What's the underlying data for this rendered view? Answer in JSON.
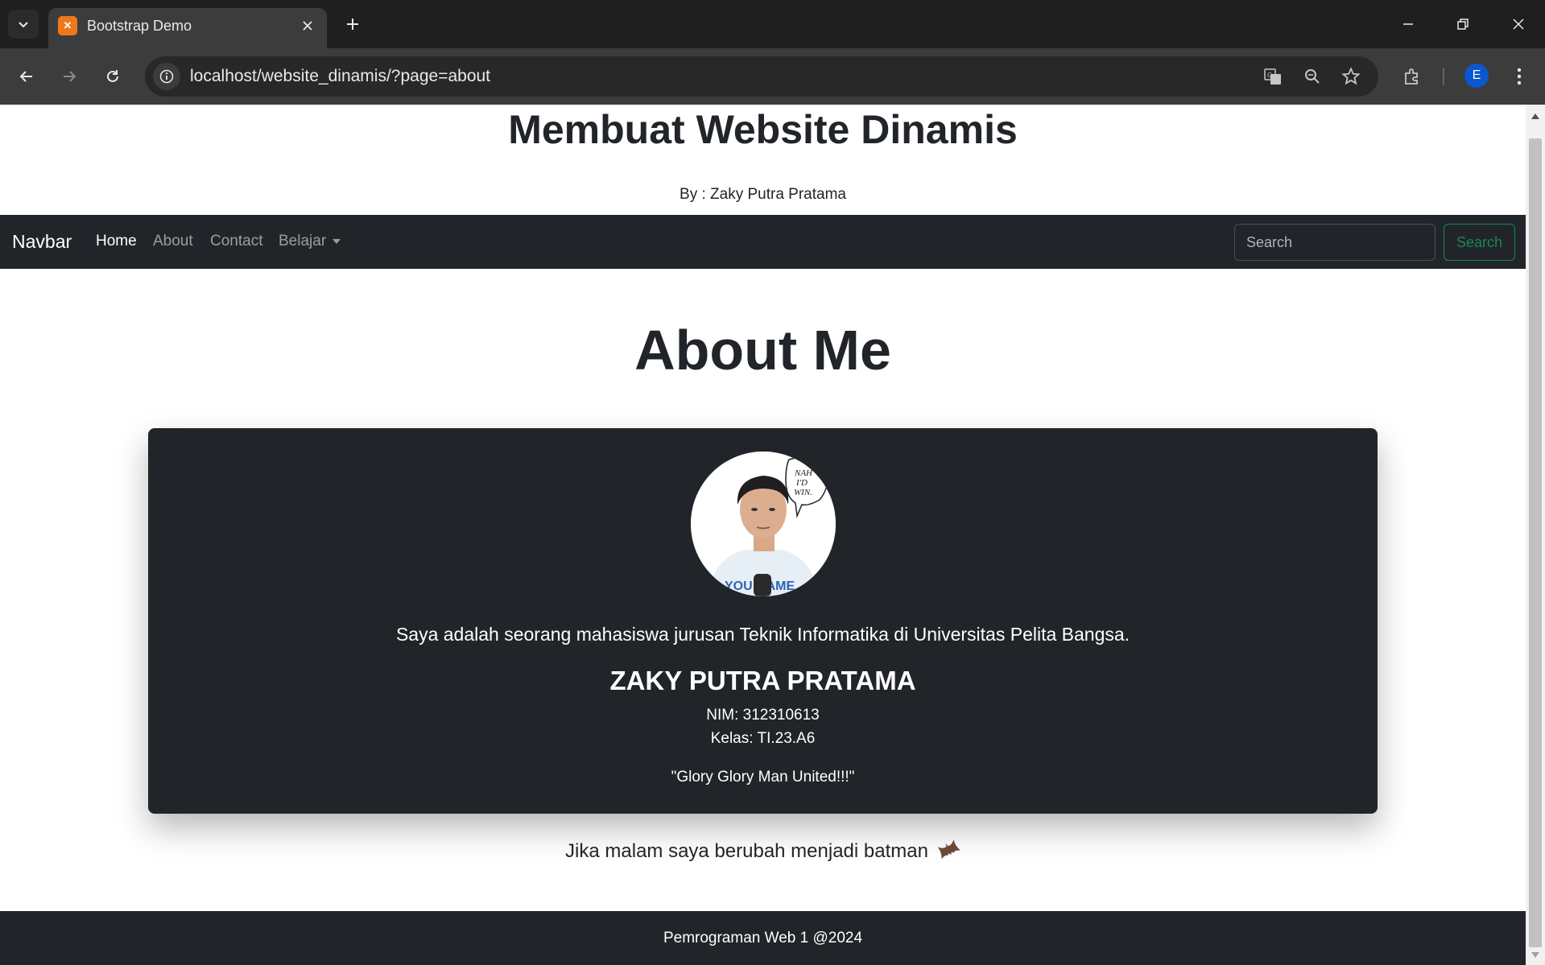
{
  "browser": {
    "tab_title": "Bootstrap Demo",
    "url": "localhost/website_dinamis/?page=about",
    "profile_initial": "E"
  },
  "header": {
    "title": "Membuat Website Dinamis",
    "author": "By : Zaky Putra Pratama"
  },
  "navbar": {
    "brand": "Navbar",
    "links": [
      {
        "label": "Home",
        "active": true
      },
      {
        "label": "About",
        "active": false
      },
      {
        "label": "Contact",
        "active": false
      },
      {
        "label": "Belajar",
        "active": false,
        "dropdown": true
      }
    ],
    "search_placeholder": "Search",
    "search_button": "Search"
  },
  "main": {
    "heading": "About Me",
    "card": {
      "speech_bubble": [
        "NAH",
        "I'D",
        "WIN."
      ],
      "shirt_text": "YOU GAME",
      "description": "Saya adalah seorang mahasiswa jurusan Teknik Informatika di Universitas Pelita Bangsa.",
      "name": "ZAKY PUTRA PRATAMA",
      "nim": "NIM: 312310613",
      "kelas": "Kelas: TI.23.A6",
      "quote": "\"Glory Glory Man United!!!\""
    },
    "tagline": "Jika malam saya berubah menjadi batman"
  },
  "footer": {
    "text": "Pemrograman Web 1 @2024"
  },
  "colors": {
    "dark": "#212529",
    "success": "#198754",
    "chrome_bg": "#1f1f1f",
    "chrome_toolbar": "#3c3c3c"
  },
  "icons": [
    "tab-search-icon",
    "xampp-favicon-icon",
    "close-icon",
    "plus-icon",
    "minimize-icon",
    "restore-icon",
    "back-icon",
    "forward-icon",
    "reload-icon",
    "site-info-icon",
    "translate-icon",
    "zoom-icon",
    "star-icon",
    "extensions-icon",
    "menu-icon",
    "bat-icon"
  ]
}
